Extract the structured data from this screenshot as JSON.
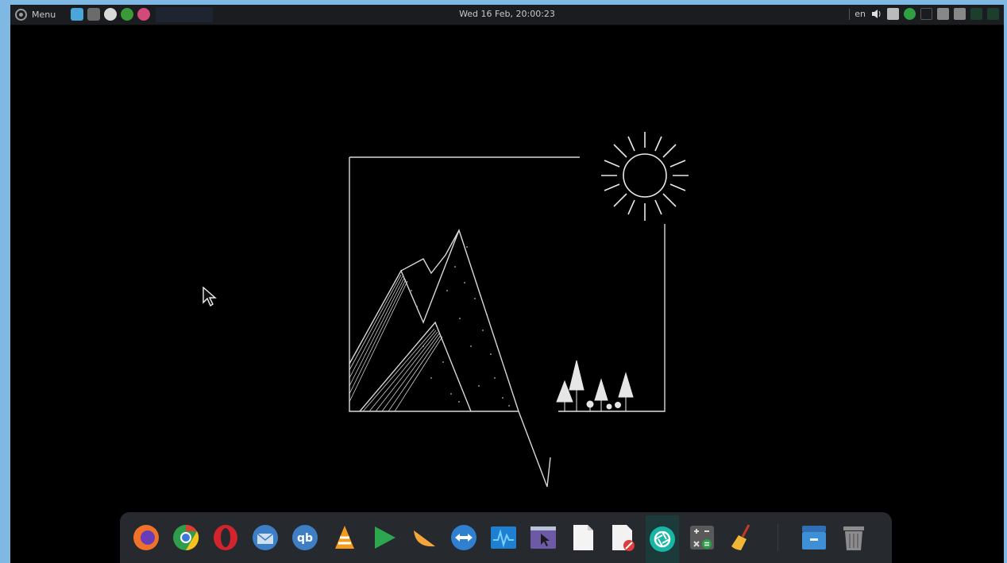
{
  "panel": {
    "menu_label": "Menu",
    "clock": "Wed 16 Feb, 20:00:23",
    "keyboard_layout": "en",
    "launchers": [
      {
        "name": "files",
        "color": "#4aa6d9"
      },
      {
        "name": "terminal",
        "color": "#6b6b6b"
      },
      {
        "name": "chrome",
        "color": "#d9d9d9"
      },
      {
        "name": "tools",
        "color": "#3a9a3a"
      },
      {
        "name": "app",
        "color": "#d24a7a"
      }
    ],
    "tray": [
      {
        "name": "volume-icon",
        "color": "#dddddd"
      },
      {
        "name": "windows-icon",
        "color": "#bbbbbb"
      },
      {
        "name": "check-icon",
        "color": "#2ea043"
      },
      {
        "name": "display-icon",
        "color": "#555555"
      },
      {
        "name": "monitor-icon",
        "color": "#888888"
      },
      {
        "name": "monitor2-icon",
        "color": "#888888"
      },
      {
        "name": "cpu-graph-icon",
        "color": "#1d3d2d"
      },
      {
        "name": "mem-graph-icon",
        "color": "#1d3d2d"
      }
    ]
  },
  "dock": {
    "apps": [
      {
        "name": "firefox",
        "color": "#f0722a",
        "accent": "#6a3db8"
      },
      {
        "name": "chrome",
        "color": "#dc3e33",
        "accent": "#2f9d4b"
      },
      {
        "name": "opera",
        "color": "#d3242d",
        "accent": "#d3242d"
      },
      {
        "name": "thunderbird",
        "color": "#3d7fc7",
        "accent": "#cfdfee"
      },
      {
        "name": "qbittorrent",
        "color": "#3e7ec4",
        "accent": "#ffffff"
      },
      {
        "name": "vlc",
        "color": "#f39a1d",
        "accent": "#ffffff"
      },
      {
        "name": "play",
        "color": "#2ca64f",
        "accent": "#1e6e34"
      },
      {
        "name": "melon",
        "color": "#f4a53a",
        "accent": "#f4a53a"
      },
      {
        "name": "teamviewer",
        "color": "#2f80d1",
        "accent": "#ffffff"
      },
      {
        "name": "monitor",
        "color": "#1f7fd0",
        "accent": "#7ad0ff"
      },
      {
        "name": "xpad",
        "color": "#6d5aa7",
        "accent": "#b9c3d8"
      },
      {
        "name": "text",
        "color": "#f4f4f4",
        "accent": "#cfcfcf"
      },
      {
        "name": "erase",
        "color": "#f2f2f2",
        "accent": "#e13a3a"
      },
      {
        "name": "aperture",
        "color": "#19b5a5",
        "accent": "#ffffff"
      },
      {
        "name": "calculator",
        "color": "#5a5a5a",
        "accent": "#2aa24a"
      },
      {
        "name": "broom",
        "color": "#f2b636",
        "accent": "#c0392b"
      }
    ],
    "pinned_right": [
      {
        "name": "file-manager",
        "color": "#3f8fd6"
      },
      {
        "name": "trash",
        "color": "#8c8c8c"
      }
    ]
  },
  "wallpaper": {
    "line_color": "#d8d8d8"
  }
}
